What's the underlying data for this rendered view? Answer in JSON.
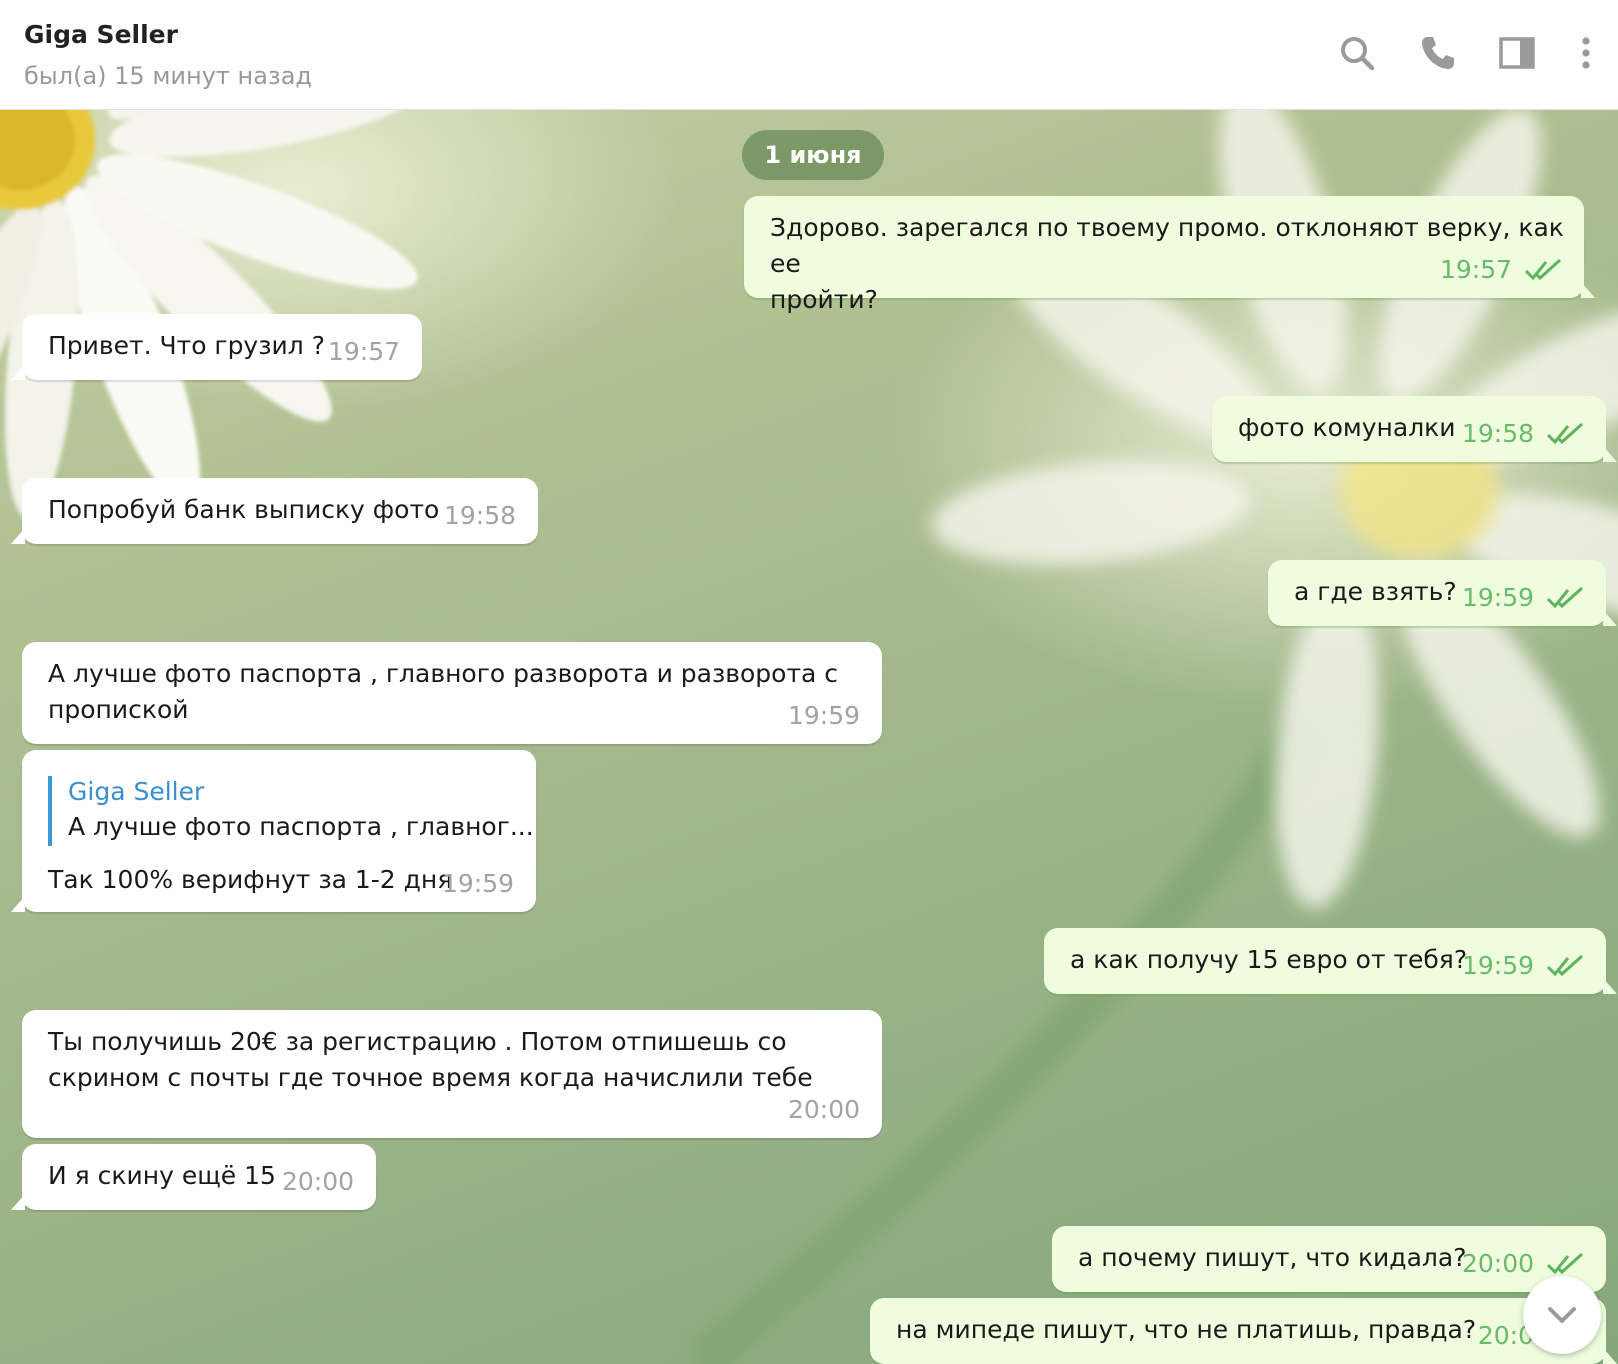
{
  "header": {
    "title": "Giga Seller",
    "status": "был(а) 15 минут назад",
    "icons": [
      "search-icon",
      "phone-icon",
      "sidebar-toggle-icon",
      "more-vertical-icon"
    ]
  },
  "date_separator": "1 июня",
  "messages": [
    {
      "direction": "out",
      "text": "Здорово. зарегался по твоему промо. отклоняют верку, как ее\nпройти?",
      "time": "19:57",
      "read": true
    },
    {
      "direction": "in",
      "text": "Привет. Что грузил ?",
      "time": "19:57"
    },
    {
      "direction": "out",
      "text": "фото комуналки",
      "time": "19:58",
      "read": true
    },
    {
      "direction": "in",
      "text": "Попробуй банк выписку фото",
      "time": "19:58"
    },
    {
      "direction": "out",
      "text": "а где взять?",
      "time": "19:59",
      "read": true
    },
    {
      "direction": "in",
      "text": "А лучше фото паспорта , главного разворота и разворота с\nпропиской",
      "time": "19:59"
    },
    {
      "direction": "in",
      "reply_author": "Giga Seller",
      "reply_text": "А лучше фото паспорта , главног...",
      "text": "Так 100% верифнут за 1-2 дня",
      "time": "19:59"
    },
    {
      "direction": "out",
      "text": "а как получу 15 евро от тебя?",
      "time": "19:59",
      "read": true
    },
    {
      "direction": "in",
      "text": "Ты получишь 20€ за регистрацию . Потом отпишешь со\nскрином с почты где точное время когда начислили тебе",
      "time": "20:00"
    },
    {
      "direction": "in",
      "text": "И я скину ещё 15",
      "time": "20:00"
    },
    {
      "direction": "out",
      "text": "а почему пишут, что кидала?",
      "time": "20:00",
      "read": true
    },
    {
      "direction": "out",
      "text": "на мипеде пишут, что не платишь, правда?",
      "time": "20:0",
      "read": true
    }
  ],
  "colors": {
    "incoming_bubble": "#ffffff",
    "outgoing_bubble": "#effdde",
    "outgoing_time": "#6bba6b",
    "reply_accent": "#3a9ad9"
  }
}
